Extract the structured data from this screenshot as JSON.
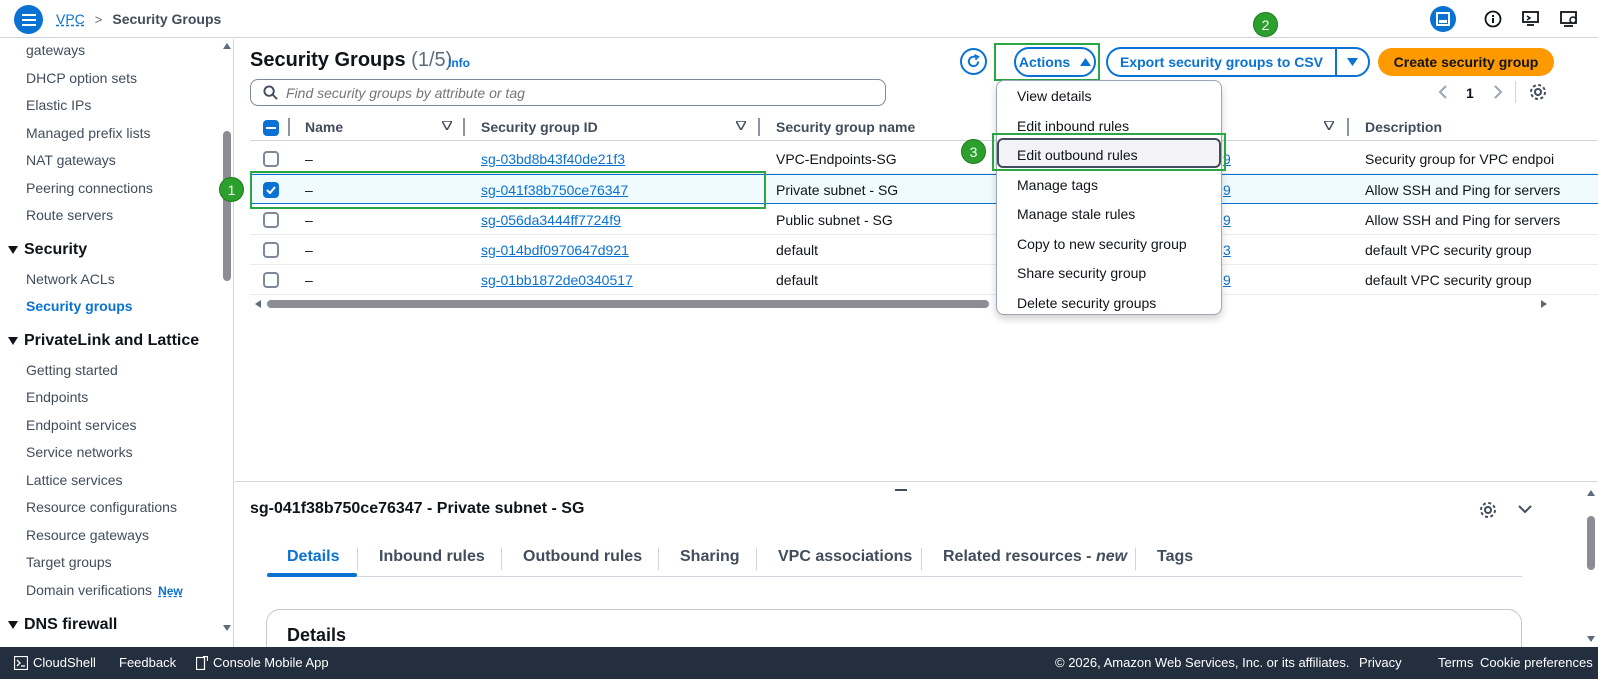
{
  "header": {
    "breadcrumb": {
      "root": "VPC",
      "current": "Security Groups"
    }
  },
  "sidebar": {
    "items_top": [
      "gateways",
      "DHCP option sets",
      "Elastic IPs",
      "Managed prefix lists",
      "NAT gateways",
      "Peering connections",
      "Route servers"
    ],
    "security": {
      "label": "Security",
      "items": [
        "Network ACLs",
        "Security groups"
      ]
    },
    "privatelink": {
      "label": "PrivateLink and Lattice",
      "items": [
        "Getting started",
        "Endpoints",
        "Endpoint services",
        "Service networks",
        "Lattice services",
        "Resource configurations",
        "Resource gateways",
        "Target groups",
        "Domain verifications"
      ]
    },
    "new_badge": "New",
    "dns": {
      "label": "DNS firewall"
    }
  },
  "main": {
    "title": "Security Groups",
    "count": "(1/5)",
    "info": "Info",
    "actions_label": "Actions",
    "export_label": "Export security groups to CSV",
    "create_label": "Create security group",
    "search_placeholder": "Find security groups by attribute or tag",
    "page": "1",
    "steps": [
      "1",
      "2",
      "3"
    ]
  },
  "table": {
    "columns": [
      "Name",
      "Security group ID",
      "Security group name",
      "Description"
    ],
    "rows": [
      {
        "name": "–",
        "id": "sg-03bd8b43f40de21f3",
        "group": "VPC-Endpoints-SG",
        "vpc": "9",
        "desc": "Security group for VPC endpoi"
      },
      {
        "name": "–",
        "id": "sg-041f38b750ce76347",
        "group": "Private subnet - SG",
        "vpc": "9",
        "desc": "Allow SSH and Ping for servers"
      },
      {
        "name": "–",
        "id": "sg-056da3444ff7724f9",
        "group": "Public subnet - SG",
        "vpc": "9",
        "desc": "Allow SSH and Ping for servers"
      },
      {
        "name": "–",
        "id": "sg-014bdf0970647d921",
        "group": "default",
        "vpc": "3",
        "desc": "default VPC security group"
      },
      {
        "name": "–",
        "id": "sg-01bb1872de0340517",
        "group": "default",
        "vpc": "9",
        "desc": "default VPC security group"
      }
    ]
  },
  "actions_menu": [
    "View details",
    "Edit inbound rules",
    "Edit outbound rules",
    "Manage tags",
    "Manage stale rules",
    "Copy to new security group",
    "Share security group",
    "Delete security groups"
  ],
  "split": {
    "title": "sg-041f38b750ce76347 - Private subnet - SG",
    "tabs": [
      "Details",
      "Inbound rules",
      "Outbound rules",
      "Sharing",
      "VPC associations",
      "Related resources - ",
      "Tags"
    ],
    "tab_new": "new",
    "details_heading": "Details"
  },
  "footer": {
    "cloudshell": "CloudShell",
    "feedback": "Feedback",
    "mobile": "Console Mobile App",
    "copyright": "© 2026, Amazon Web Services, Inc. or its affiliates.",
    "privacy": "Privacy",
    "terms": "Terms",
    "cookies": "Cookie preferences"
  },
  "colors": {
    "accent": "#0972d3",
    "primary_button": "#ff9900",
    "annotation": "#29a745",
    "footer": "#232f3e"
  }
}
